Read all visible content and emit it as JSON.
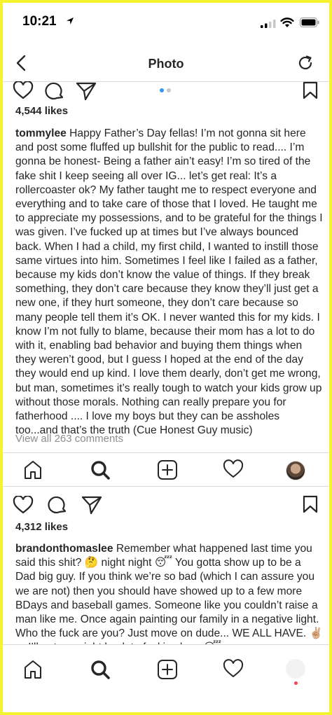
{
  "status": {
    "time": "10:21"
  },
  "nav": {
    "title": "Photo"
  },
  "post1": {
    "likes": "4,544 likes",
    "username": "tommylee",
    "caption": "Happy Father’s Day fellas! I’m not gonna sit here and post some fluffed up bullshit for the public to read.... I’m gonna be honest- Being a father ain’t easy! I’m so tired of the fake shit I keep seeing all over IG... let’s get real: It’s a rollercoaster ok? My father taught me to respect everyone and everything and to take care of those that I loved. He taught me to appreciate my possessions, and to be grateful for the things I was given. I’ve fucked up at times but I’ve always bounced back. When I had a child, my first child, I wanted to instill those same virtues into him. Sometimes I feel like I failed as a father, because my kids don’t know the value of things. If they break something, they don’t care because they know they’ll just get a new one, if they hurt someone, they don’t care because so many people tell them it’s OK. I never wanted this for my kids. I know I’m not fully to blame, because their mom has a lot to do with it, enabling bad behavior and buying them things when they weren’t good, but I guess I hoped at the end of the day they would end up kind. I love them dearly, don’t get me wrong, but man, sometimes it’s really tough to watch your kids grow up without those morals. Nothing can really prepare you for fatherhood .... I love my boys but they can be assholes too...and that’s the truth (Cue Honest Guy music)",
    "view_comments": "View all 263 comments"
  },
  "post2": {
    "likes": "4,312 likes",
    "username": "brandonthomaslee",
    "caption": "Remember what happened last time you said this shit? 🤔 night night 😴 You gotta show up to be a Dad big guy. If you think we’re so bad (which I can assure you we are not) then you should have showed up to a few more BDays and baseball games. Someone like you couldn’t raise a man like me. Once again painting our family in a negative light. Who the fuck are you? Just move on dude... WE ALL HAVE. ✌🏼 or I’ll put you right back to fuckin sleep 😴"
  },
  "icons": {
    "back": "chevron-left-icon",
    "refresh": "refresh-icon",
    "like": "heart-icon",
    "comment": "comment-bubble-icon",
    "share": "paper-plane-icon",
    "save": "bookmark-icon",
    "home": "home-icon",
    "search": "search-icon",
    "new_post": "plus-square-icon",
    "activity": "heart-icon",
    "profile": "avatar"
  },
  "colors": {
    "accent": "#3897f0",
    "border": "#f5f22e",
    "muted": "#8e8e8e",
    "notification": "#ed4956"
  }
}
